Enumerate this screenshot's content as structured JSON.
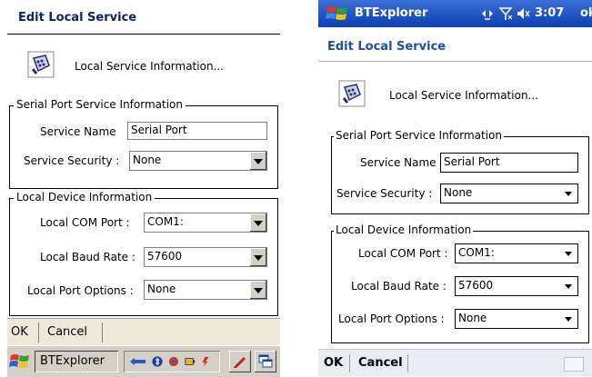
{
  "left": {
    "title": "Edit Local Service",
    "info_text": "Local Service Information...",
    "serial_group": {
      "legend": "Serial Port Service Information",
      "service_name_label": "Service Name",
      "service_name_value": "Serial Port",
      "security_label": "Service Security :",
      "security_value": "None"
    },
    "device_group": {
      "legend": "Local Device Information",
      "com_label": "Local COM Port :",
      "com_value": "COM1:",
      "baud_label": "Local Baud Rate :",
      "baud_value": "57600",
      "options_label": "Local Port Options :",
      "options_value": "None"
    },
    "menu": {
      "ok": "OK",
      "cancel": "Cancel"
    },
    "taskbar": {
      "task": "BTExplorer"
    }
  },
  "right": {
    "statusbar": {
      "app": "BTExplorer",
      "time": "3:07",
      "ok": "ok"
    },
    "title": "Edit Local Service",
    "info_text": "Local Service Information...",
    "serial_group": {
      "legend": "Serial Port Service Information",
      "service_name_label": "Service Name",
      "service_name_value": "Serial Port",
      "security_label": "Service Security :",
      "security_value": "None"
    },
    "device_group": {
      "legend": "Local Device Information",
      "com_label": "Local COM Port :",
      "com_value": "COM1:",
      "baud_label": "Local Baud Rate :",
      "baud_value": "57600",
      "options_label": "Local Port Options :",
      "options_value": "None"
    },
    "menu": {
      "ok": "OK",
      "cancel": "Cancel"
    }
  },
  "icons": {
    "serial_port": "serial-port-icon",
    "windows_logo": "windows-logo-icon",
    "connectivity": "connectivity-icon",
    "signal": "signal-icon",
    "volume": "volume-icon",
    "keyboard": "keyboard-icon",
    "dropdown": "chevron-down-icon"
  },
  "colors": {
    "title_text": "#0a246a",
    "status_bar": "#0b3fb0",
    "taskbar": "#d4d0c8"
  }
}
